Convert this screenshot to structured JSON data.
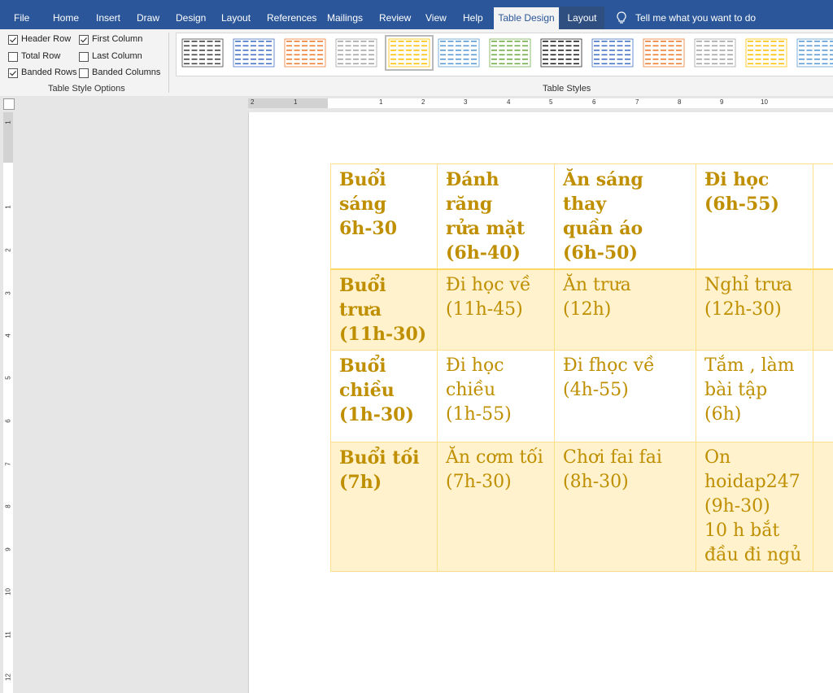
{
  "tabs": [
    {
      "label": "File"
    },
    {
      "label": "Home"
    },
    {
      "label": "Insert"
    },
    {
      "label": "Draw"
    },
    {
      "label": "Design"
    },
    {
      "label": "Layout"
    },
    {
      "label": "References"
    },
    {
      "label": "Mailings"
    },
    {
      "label": "Review"
    },
    {
      "label": "View"
    },
    {
      "label": "Help"
    },
    {
      "label": "Table Design",
      "active": true
    },
    {
      "label": "Layout",
      "contextual": true
    }
  ],
  "tell_me": "Tell me what you want to do",
  "style_options": {
    "group_label": "Table Style Options",
    "items": [
      {
        "label": "Header Row",
        "checked": true
      },
      {
        "label": "First Column",
        "checked": true
      },
      {
        "label": "Total Row",
        "checked": false
      },
      {
        "label": "Last Column",
        "checked": false
      },
      {
        "label": "Banded Rows",
        "checked": true
      },
      {
        "label": "Banded Columns",
        "checked": false
      }
    ]
  },
  "table_styles": {
    "group_label": "Table Styles",
    "colors": [
      "#444444",
      "#4472c4",
      "#ed7d31",
      "#a5a5a5",
      "#ffc000",
      "#5b9bd5",
      "#70ad47",
      "#222222",
      "#4472c4",
      "#ed7d31",
      "#a5a5a5",
      "#ffc000",
      "#5b9bd5"
    ],
    "selected_index": 4
  },
  "ruler": {
    "h_numbers": [
      "2",
      "1",
      "1",
      "2",
      "3",
      "4",
      "5",
      "6",
      "7",
      "8",
      "9",
      "10"
    ],
    "v_numbers": [
      "1",
      "1",
      "2",
      "3",
      "4",
      "5",
      "6",
      "7",
      "8",
      "9",
      "10",
      "11",
      "12"
    ]
  },
  "colors": {
    "ribbon_blue": "#2b579a",
    "table_text": "#bf8f00",
    "band": "#fff2cc",
    "border": "#ffe08a"
  },
  "table": {
    "rows": [
      [
        "Buổi sáng\n6h-30",
        "Đánh răng\nrửa mặt\n(6h-40)",
        "Ăn sáng thay\nquần áo\n(6h-50)",
        "Đi học\n(6h-55)"
      ],
      [
        "Buổi trưa\n(11h-30)",
        "Đi học về\n(11h-45)",
        "Ăn trưa\n(12h)",
        "Nghỉ trưa\n(12h-30)"
      ],
      [
        "Buổi\nchiều\n(1h-30)",
        "Đi học\nchiều\n(1h-55)",
        "Đi fhọc về\n(4h-55)",
        "Tắm , làm\nbài tập\n(6h)"
      ],
      [
        "Buổi tối\n(7h)",
        "Ăn cơm tối\n(7h-30)",
        "Chơi fai fai\n(8h-30)",
        "On\nhoidap247\n(9h-30)\n10 h bắt\nđầu đi ngủ"
      ]
    ]
  }
}
